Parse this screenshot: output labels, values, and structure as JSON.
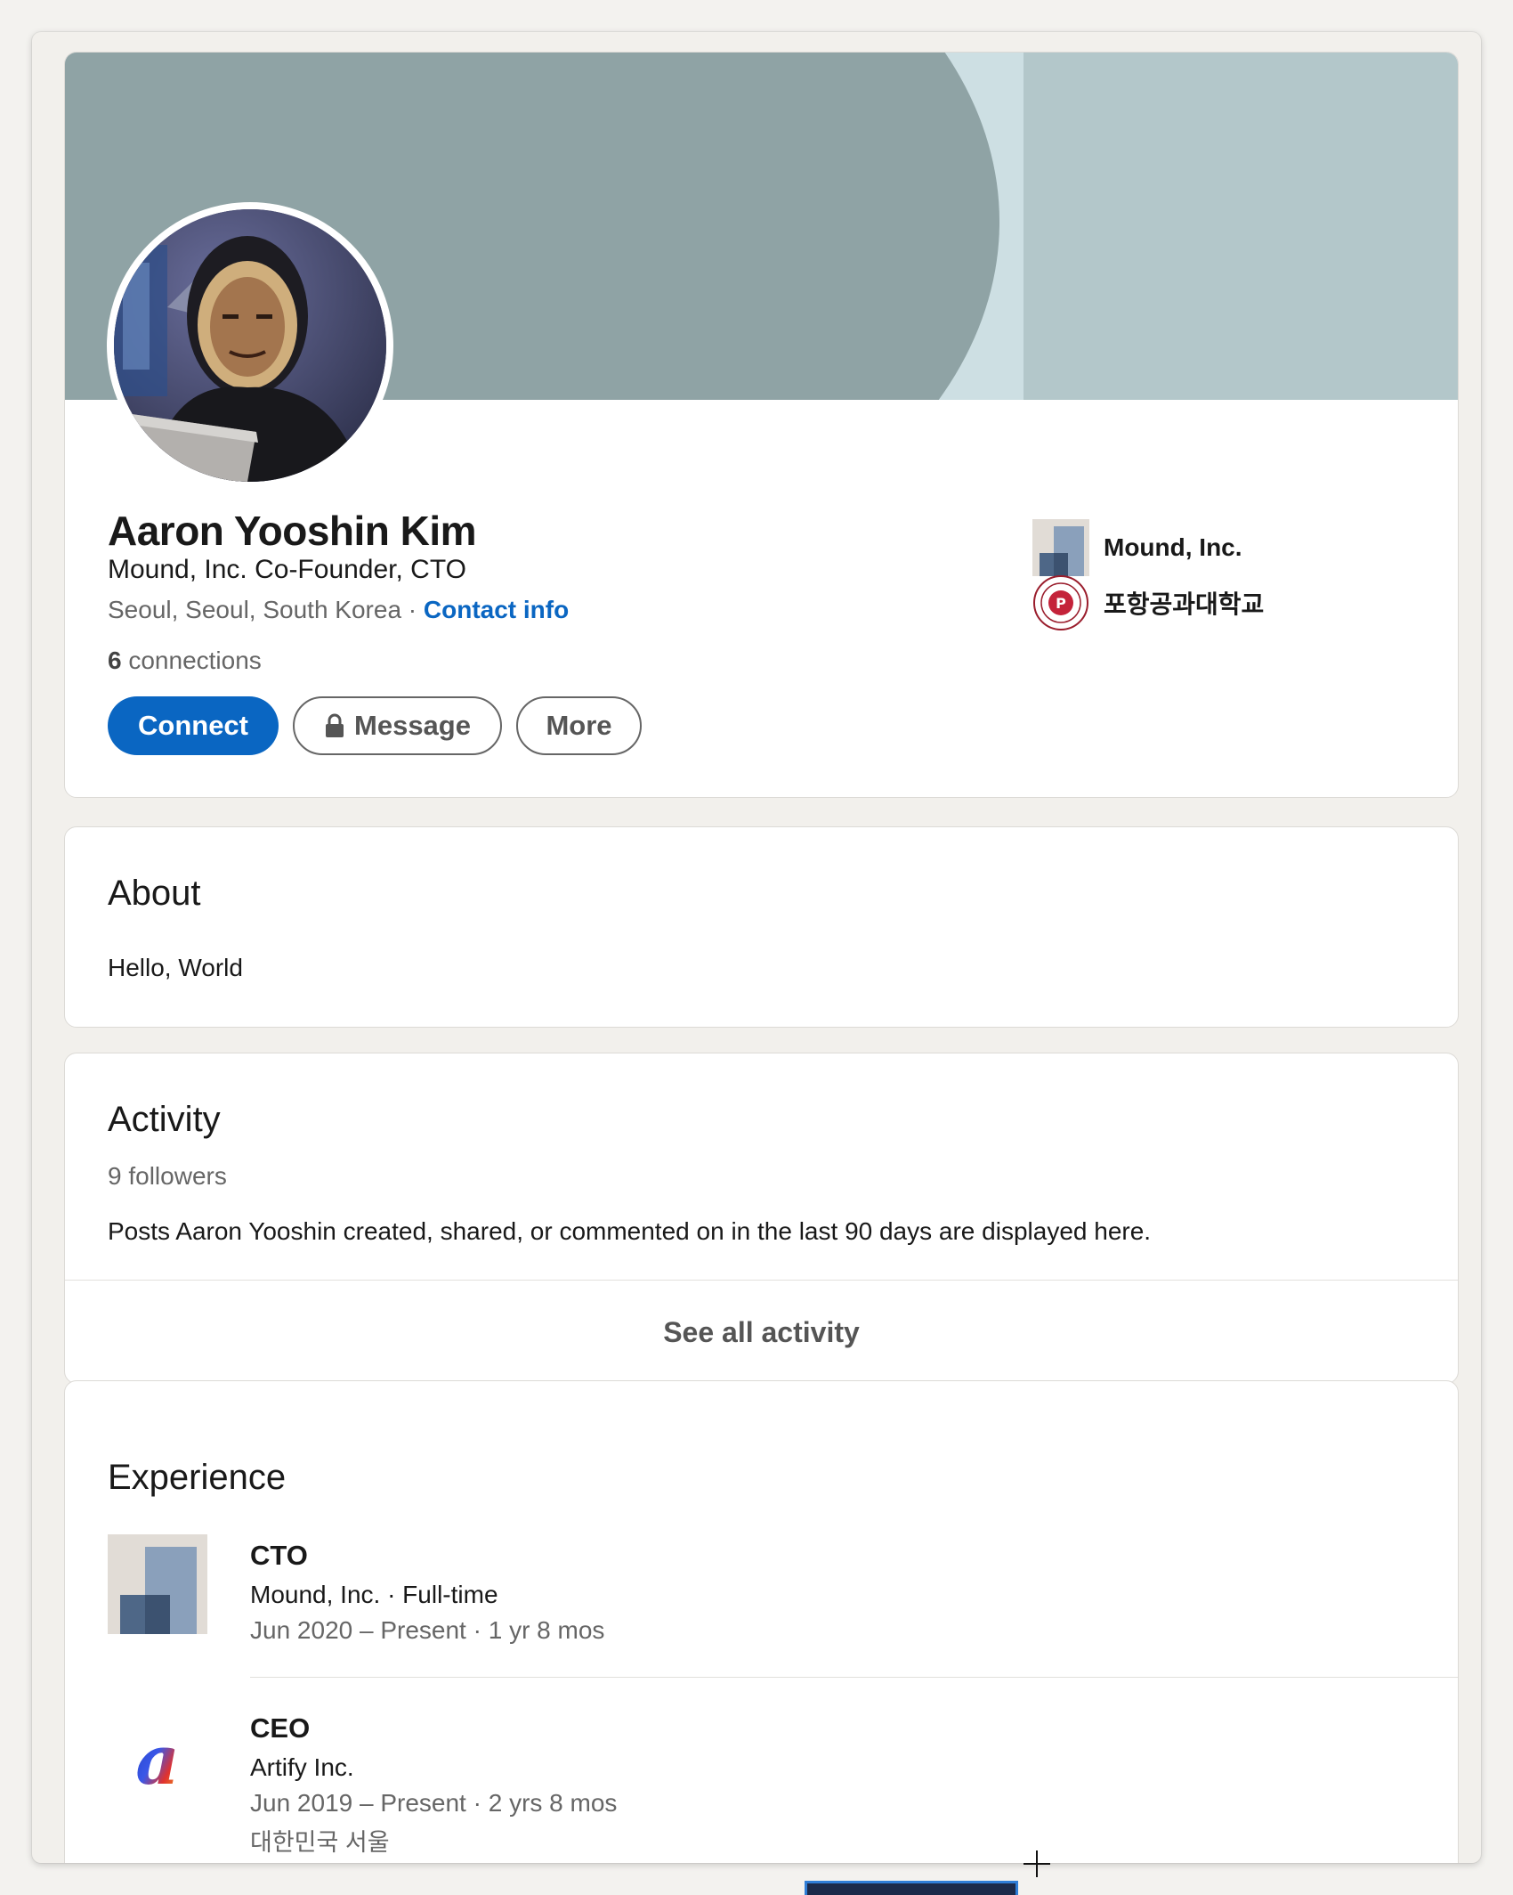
{
  "profile": {
    "name": "Aaron Yooshin Kim",
    "headline": "Mound, Inc. Co-Founder, CTO",
    "location": "Seoul, Seoul, South Korea",
    "separator": " · ",
    "contact_info": "Contact info",
    "connections_count": "6",
    "connections_label": " connections",
    "buttons": {
      "connect": "Connect",
      "message": "Message",
      "more": "More"
    }
  },
  "side": {
    "company": "Mound, Inc.",
    "school": "포항공과대학교"
  },
  "about": {
    "title": "About",
    "text": "Hello, World"
  },
  "activity": {
    "title": "Activity",
    "followers": "9 followers",
    "text": "Posts Aaron Yooshin created, shared, or commented on in the last 90 days are displayed here.",
    "see_all": "See all activity"
  },
  "experience": {
    "title": "Experience",
    "items": [
      {
        "title": "CTO",
        "company": "Mound, Inc. · Full-time",
        "dates": "Jun 2020 – Present · 1 yr 8 mos",
        "location": ""
      },
      {
        "title": "CEO",
        "company": "Artify Inc.",
        "dates": "Jun 2019 – Present · 2 yrs 8 mos",
        "location": "대한민국 서울"
      }
    ]
  },
  "colors": {
    "accent": "#0a66c2",
    "banner_dark": "#8fa3a5",
    "banner_light": "#cddfe3",
    "banner_right": "#b3c7ca"
  }
}
